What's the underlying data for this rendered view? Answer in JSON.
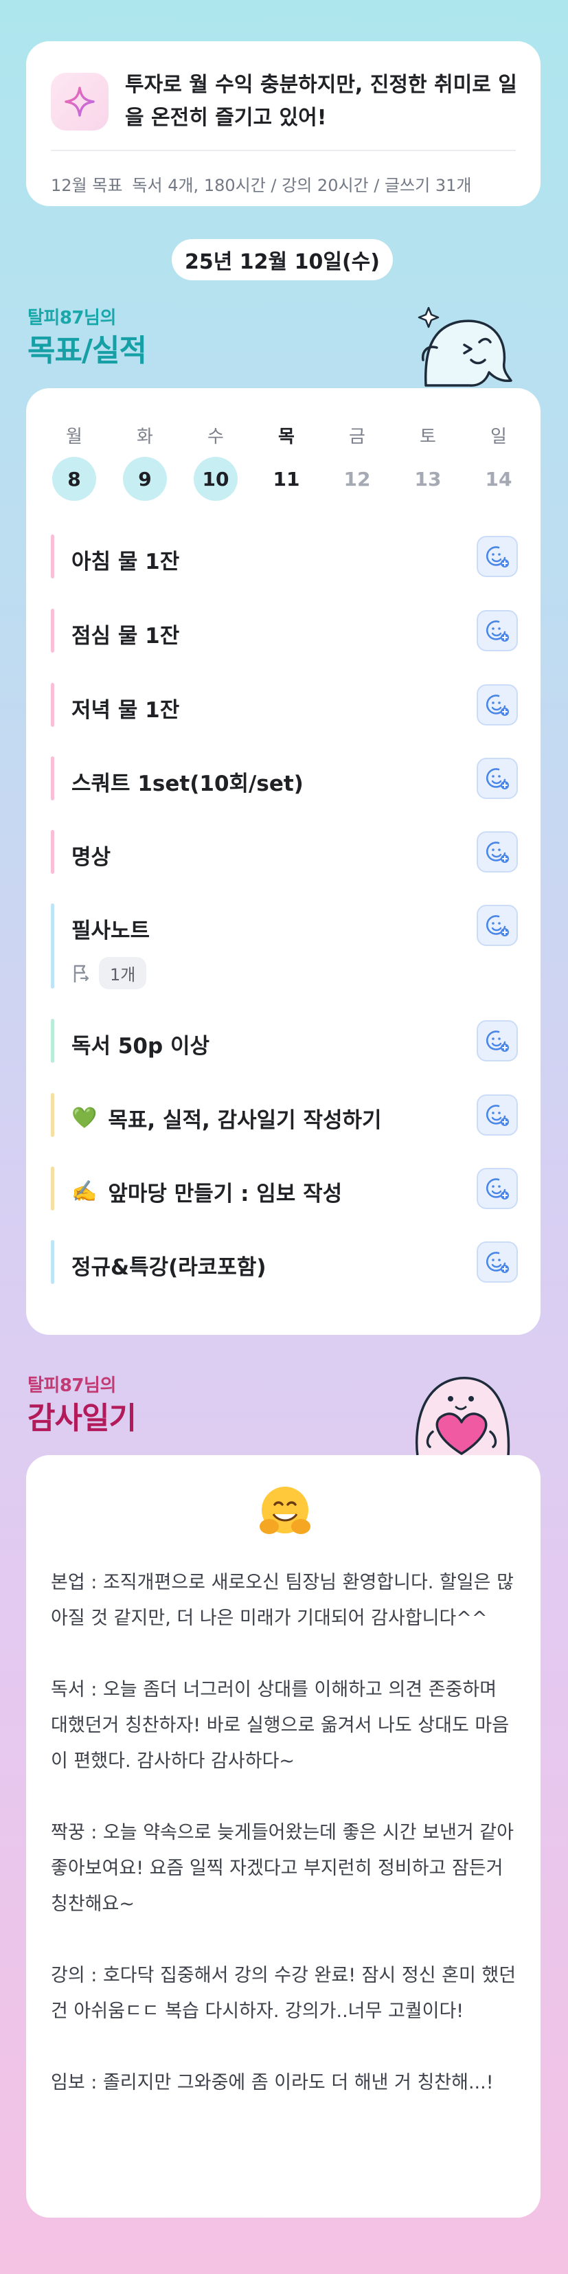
{
  "banner": {
    "motto": "투자로 월 수익 충분하지만, 진정한 취미로 일을 온전히 즐기고 있어!",
    "goal_prefix": "12월 목표",
    "goal_text": "독서 4개, 180시간 / 강의 20시간 / 글쓰기 31개",
    "icon": "sparkle-icon"
  },
  "date_label": "25년 12월 10일(수)",
  "goals_section": {
    "owner": "탈피87님의",
    "title": "목표/실적",
    "title_color": "#1aa7a9"
  },
  "week": {
    "days": [
      {
        "name": "월",
        "num": "8",
        "status": "done"
      },
      {
        "name": "화",
        "num": "9",
        "status": "done"
      },
      {
        "name": "수",
        "num": "10",
        "status": "done"
      },
      {
        "name": "목",
        "num": "11",
        "status": "today"
      },
      {
        "name": "금",
        "num": "12",
        "status": "future"
      },
      {
        "name": "토",
        "num": "13",
        "status": "future"
      },
      {
        "name": "일",
        "num": "14",
        "status": "future"
      }
    ]
  },
  "tasks": [
    {
      "label": "아침 물 1잔",
      "bar_color": "#f8bfd6",
      "emoji": ""
    },
    {
      "label": "점심 물 1잔",
      "bar_color": "#f8bfd6",
      "emoji": ""
    },
    {
      "label": "저녁 물 1잔",
      "bar_color": "#f8bfd6",
      "emoji": ""
    },
    {
      "label": "스쿼트 1set(10회/set)",
      "bar_color": "#f8bfd6",
      "emoji": ""
    },
    {
      "label": "명상",
      "bar_color": "#f8bfd6",
      "emoji": ""
    },
    {
      "label": "필사노트",
      "bar_color": "#bfe3f8",
      "emoji": "",
      "sub_count": "1개"
    },
    {
      "label": "독서 50p 이상",
      "bar_color": "#b9ecd9",
      "emoji": ""
    },
    {
      "label": "목표, 실적, 감사일기 작성하기",
      "bar_color": "#f7dea3",
      "emoji": "💚"
    },
    {
      "label": "앞마당 만들기 : 임보 작성",
      "bar_color": "#f7dea3",
      "emoji": "✍️"
    },
    {
      "label": "정규&특강(라코포함)",
      "bar_color": "#bfe3f8",
      "emoji": ""
    }
  ],
  "gratitude_section": {
    "owner": "탈피87님의",
    "title": "감사일기",
    "title_color": "#b21a5a",
    "emoji": "🤗"
  },
  "journal": [
    "본업 : 조직개편으로 새로오신 팀장님 환영합니다. 할일은 많아질 것 같지만, 더 나은 미래가 기대되어 감사합니다^^",
    "독서 : 오늘 좀더 너그러이 상대를 이해하고 의견 존중하며 대했던거 칭찬하자! 바로 실행으로 옮겨서 나도 상대도 마음이 편했다. 감사하다 감사하다~",
    "짝꿍 : 오늘 약속으로 늦게들어왔는데 좋은 시간 보낸거 같아 좋아보여요! 요즘 일찍 자겠다고 부지런히 정비하고 잠든거 칭찬해요~",
    "강의 : 호다닥 집중해서 강의 수강 완료! 잠시 정신 혼미 했던건 아쉬움ㄷㄷ 복습 다시하자. 강의가..너무 고퀄이다!",
    "임보 : 졸리지만 그와중에 좀 이라도 더 해낸 거 칭찬해...!"
  ]
}
